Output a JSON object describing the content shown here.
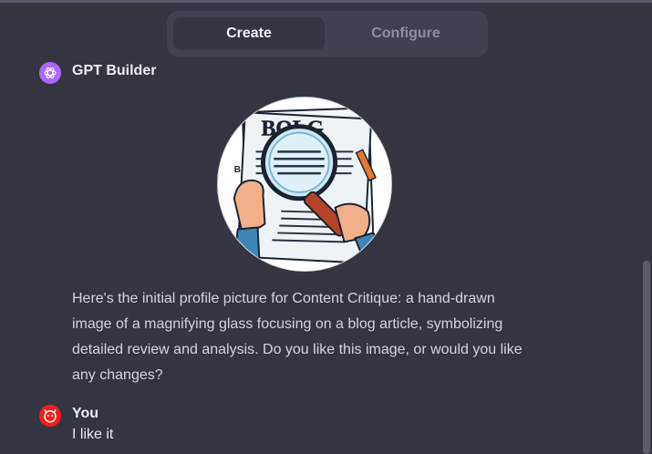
{
  "tabs": [
    {
      "label": "Create",
      "active": true
    },
    {
      "label": "Configure",
      "active": false
    }
  ],
  "conversation": {
    "assistant": {
      "name": "GPT Builder",
      "image_title": "BOLG",
      "image_side_letter": "B",
      "message": "Here's the initial profile picture for Content Critique: a hand-drawn image of a magnifying glass focusing on a blog article, symbolizing detailed review and analysis. Do you like this image, or would you like any changes?"
    },
    "user": {
      "name": "You",
      "message": "I like it"
    }
  },
  "colors": {
    "background": "#343541",
    "segmented_bg": "#40414f",
    "builder_avatar": "#ab68ff",
    "user_avatar": "#ef1f1f"
  }
}
